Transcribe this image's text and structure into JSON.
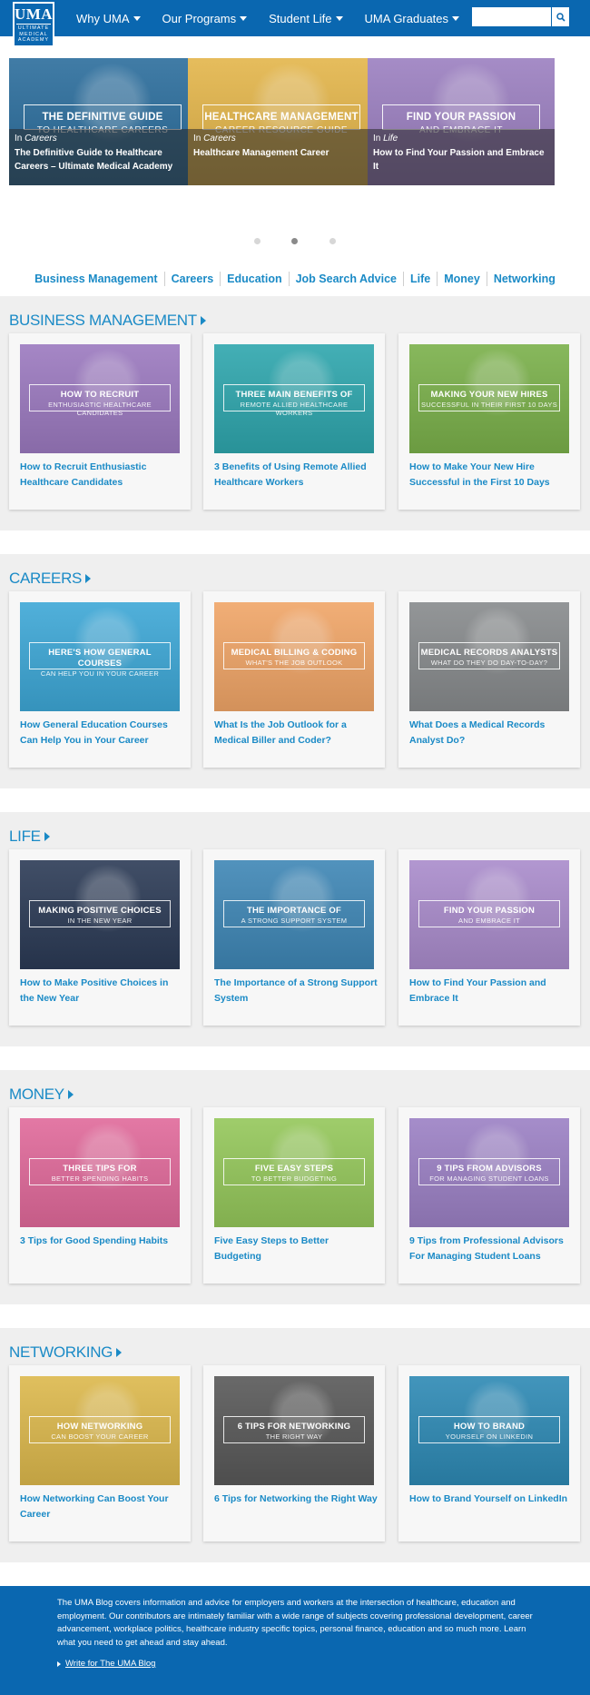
{
  "header": {
    "logo": {
      "mark": "UMA",
      "sub": "ULTIMATE MEDICAL ACADEMY"
    },
    "nav": [
      "Why UMA",
      "Our Programs",
      "Student Life",
      "UMA Graduates"
    ],
    "search_placeholder": ""
  },
  "slider": [
    {
      "frame_title": "THE DEFINITIVE GUIDE",
      "frame_sub": "TO HEALTHCARE CAREERS",
      "in_prefix": "In ",
      "category": "Careers",
      "title": "The Definitive Guide to Healthcare Careers – Ultimate Medical Academy",
      "color": "#2b6d9c"
    },
    {
      "frame_title": "HEALTHCARE MANAGEMENT",
      "frame_sub": "CAREER RESOURCE GUIDE",
      "in_prefix": "In ",
      "category": "Careers",
      "title": "Healthcare Management Career",
      "color": "#e3b54a"
    },
    {
      "frame_title": "FIND YOUR PASSION",
      "frame_sub": "AND EMBRACE IT",
      "in_prefix": "In ",
      "category": "Life",
      "title": "How to Find Your Passion and Embrace It",
      "color": "#9b7fc0"
    }
  ],
  "slider_dots": {
    "count": 3,
    "active": 2
  },
  "categories": [
    "Business Management",
    "Careers",
    "Education",
    "Job Search Advice",
    "Life",
    "Money",
    "Networking"
  ],
  "sections": [
    {
      "title": "BUSINESS MANAGEMENT",
      "cards": [
        {
          "frame_title": "HOW TO RECRUIT",
          "frame_sub": "ENTHUSIASTIC HEALTHCARE CANDIDATES",
          "title": "How to Recruit Enthusiastic Healthcare Candidates",
          "color": "#9b79bf"
        },
        {
          "frame_title": "THREE MAIN BENEFITS OF",
          "frame_sub": "REMOTE ALLIED HEALTHCARE WORKERS",
          "title": "3 Benefits of Using Remote Allied Healthcare Workers",
          "color": "#2ea6ad"
        },
        {
          "frame_title": "MAKING YOUR NEW HIRES",
          "frame_sub": "SUCCESSFUL IN THEIR FIRST 10 DAYS",
          "title": "How to Make Your New Hire Successful in the First 10 Days",
          "color": "#7ab04a"
        }
      ]
    },
    {
      "title": "CAREERS",
      "cards": [
        {
          "frame_title": "HERE'S HOW GENERAL COURSES",
          "frame_sub": "CAN HELP YOU IN YOUR CAREER",
          "title": "How General Education Courses Can Help You in Your Career",
          "color": "#3da7d6"
        },
        {
          "frame_title": "MEDICAL BILLING & CODING",
          "frame_sub": "WHAT'S THE JOB OUTLOOK",
          "title": "What Is the Job Outlook for a Medical Biller and Coder?",
          "color": "#f0a567"
        },
        {
          "frame_title": "MEDICAL RECORDS ANALYSTS",
          "frame_sub": "WHAT DO THEY DO DAY-TO-DAY?",
          "title": "What Does a Medical Records Analyst Do?",
          "color": "#878a8c"
        }
      ]
    },
    {
      "title": "LIFE",
      "cards": [
        {
          "frame_title": "MAKING POSITIVE CHOICES",
          "frame_sub": "IN THE NEW YEAR",
          "title": "How to Make Positive Choices in the New Year",
          "color": "#2b3a55"
        },
        {
          "frame_title": "THE IMPORTANCE OF",
          "frame_sub": "A STRONG SUPPORT SYSTEM",
          "title": "The Importance of a Strong Support System",
          "color": "#3e86b5"
        },
        {
          "frame_title": "FIND YOUR PASSION",
          "frame_sub": "AND EMBRACE IT",
          "title": "How to Find Your Passion and Embrace It",
          "color": "#a98bcb"
        }
      ]
    },
    {
      "title": "MONEY",
      "cards": [
        {
          "frame_title": "THREE TIPS FOR",
          "frame_sub": "BETTER SPENDING HABITS",
          "title": "3 Tips for Good Spending Habits",
          "color": "#e0699a"
        },
        {
          "frame_title": "FIVE EASY STEPS",
          "frame_sub": "TO BETTER BUDGETING",
          "title": "Five Easy Steps to Better Budgeting",
          "color": "#94c75a"
        },
        {
          "frame_title": "9 TIPS FROM ADVISORS",
          "frame_sub": "FOR MANAGING STUDENT LOANS",
          "title": "9 Tips from Professional Advisors For Managing Student Loans",
          "color": "#9b80c4"
        }
      ]
    },
    {
      "title": "NETWORKING",
      "cards": [
        {
          "frame_title": "HOW NETWORKING",
          "frame_sub": "CAN BOOST YOUR CAREER",
          "title": "How Networking Can Boost Your Career",
          "color": "#dcb84c"
        },
        {
          "frame_title": "6 TIPS FOR NETWORKING",
          "frame_sub": "THE RIGHT WAY",
          "title": "6 Tips for Networking the Right Way",
          "color": "#585858"
        },
        {
          "frame_title": "HOW TO BRAND",
          "frame_sub": "YOURSELF ON LINKEDIN",
          "title": "How to Brand Yourself on LinkedIn",
          "color": "#2d89b4"
        }
      ]
    }
  ],
  "footer": {
    "text": "The UMA Blog covers information and advice for employers and workers at the intersection of healthcare, education and employment. Our contributors are intimately familiar with a wide range of subjects covering professional development, career advancement, workplace politics, healthcare industry specific topics, personal finance, education and so much more. Learn what you need to get ahead and stay ahead.",
    "link": "Write for The UMA Blog"
  },
  "colors": {
    "brand_blue": "#0a67b0",
    "link_blue": "#1a8ac6",
    "section_bg": "#efefef"
  }
}
